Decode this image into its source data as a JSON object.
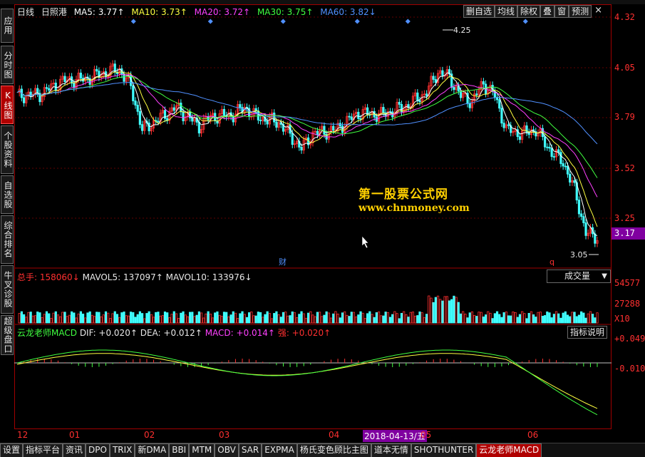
{
  "legend": {
    "period": "日线",
    "stock": "日照港",
    "ma5": "MA5: 3.77↑",
    "ma10": "MA10: 3.73↑",
    "ma20": "MA20: 3.72↑",
    "ma30": "MA30: 3.75↑",
    "ma60": "MA60: 3.82↓"
  },
  "toolbar": [
    "删自选",
    "均线",
    "除权",
    "叠",
    "窗",
    "预测"
  ],
  "close_glyph": "×",
  "side_tabs": [
    {
      "label": "应用",
      "active": false
    },
    {
      "label": "分时图",
      "active": false
    },
    {
      "label": "K线图",
      "active": true
    },
    {
      "label": "个股资料",
      "active": false
    },
    {
      "label": "自选股",
      "active": false
    },
    {
      "label": "综合排名",
      "active": false
    },
    {
      "label": "牛叉诊股",
      "active": false
    },
    {
      "label": "超级盘口",
      "active": false
    }
  ],
  "price_axis": [
    "4.32",
    "4.05",
    "3.79",
    "3.52",
    "3.25"
  ],
  "current_price": "3.17",
  "annotations": {
    "high": "4.25",
    "low": "3.05",
    "cai": "财",
    "q": "q"
  },
  "watermark": {
    "line1": "第一股票公式网",
    "line2": "www.chnmoney.com"
  },
  "volume": {
    "legend_total": "总手: 158060↓",
    "legend_ma5": "MAVOL5: 137097↑",
    "legend_ma10": "MAVOL10: 133976↓",
    "selector": "成交量",
    "axis": [
      "54577",
      "27288",
      "X10"
    ]
  },
  "macd": {
    "name": "云龙老师MACD",
    "dif": "DIF: +0.020↑",
    "dea": "DEA: +0.012↑",
    "macd": "MACD: +0.014↑",
    "qiang": "强: +0.020↑",
    "help": "指标说明",
    "axis": [
      "+0.049",
      "-0.010"
    ]
  },
  "x_axis": [
    "12",
    "01",
    "02",
    "03",
    "04",
    "05",
    "06"
  ],
  "x_highlight": "2018-04-13/五",
  "bottom_tabs": [
    {
      "label": "设置",
      "active": false
    },
    {
      "label": "指标平台",
      "active": false
    },
    {
      "label": "资讯",
      "active": false
    },
    {
      "label": "DPO",
      "active": false
    },
    {
      "label": "TRIX",
      "active": false
    },
    {
      "label": "新DMA",
      "active": false
    },
    {
      "label": "BBI",
      "active": false
    },
    {
      "label": "MTM",
      "active": false
    },
    {
      "label": "OBV",
      "active": false
    },
    {
      "label": "SAR",
      "active": false
    },
    {
      "label": "EXPMA",
      "active": false
    },
    {
      "label": "杨氏变色顾比主图",
      "active": false
    },
    {
      "label": "道本无情",
      "active": false
    },
    {
      "label": "SHOTHUNTER",
      "active": false
    },
    {
      "label": "云龙老师MACD",
      "active": true
    }
  ],
  "colors": {
    "up": "#ff3030",
    "down": "#40ffff",
    "ma5": "#ffffff",
    "ma10": "#ffff40",
    "ma20": "#ff40ff",
    "ma30": "#40ff40",
    "ma60": "#5090ff",
    "frame": "#a00000"
  }
}
